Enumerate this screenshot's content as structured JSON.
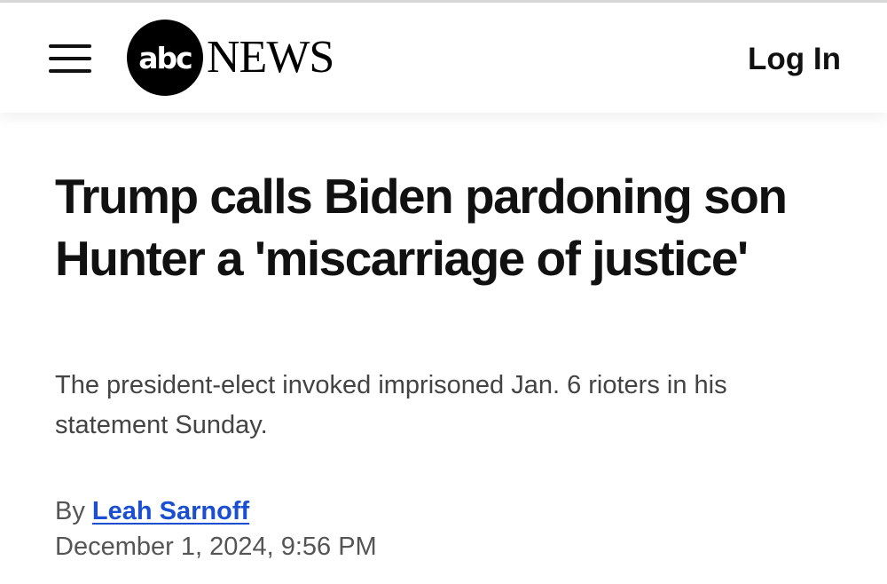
{
  "header": {
    "menu_icon": "hamburger-menu-icon",
    "logo": {
      "mark": "abc",
      "word": "NEWS"
    },
    "login_label": "Log In"
  },
  "article": {
    "headline": "Trump calls Biden pardoning son Hunter a 'miscarriage of justice'",
    "subheadline": "The president-elect invoked imprisoned Jan. 6 rioters in his statement Sunday.",
    "byline_prefix": "By",
    "author": "Leah Sarnoff",
    "date": "December 1, 2024, 9:56 PM"
  },
  "colors": {
    "author_link": "#1a4fd1",
    "text": "#111111",
    "muted_text": "#555555"
  }
}
